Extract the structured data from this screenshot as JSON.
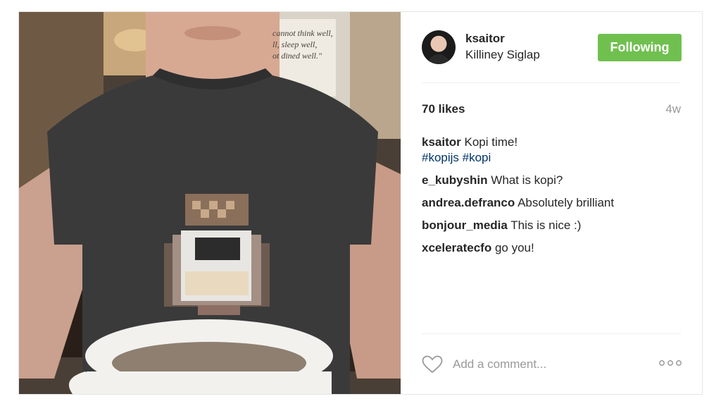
{
  "post": {
    "username": "ksaitor",
    "location": "Killiney Siglap",
    "follow_label": "Following",
    "likes": "70 likes",
    "time_ago": "4w"
  },
  "caption": {
    "user": "ksaitor",
    "text": "Kopi time!",
    "tags": "#kopijs #kopi"
  },
  "comments": [
    {
      "user": "e_kubyshin",
      "text": "What is kopi?"
    },
    {
      "user": "andrea.defranco",
      "text": "Absolutely brilliant"
    },
    {
      "user": "bonjour_media",
      "text": "This is nice :)"
    },
    {
      "user": "xceleratecfo",
      "text": "go you!"
    }
  ],
  "photo_sign": [
    "cannot think well,",
    "ll, sleep well,",
    "ot dined well.\""
  ],
  "footer": {
    "comment_placeholder": "Add a comment..."
  },
  "colors": {
    "follow_green": "#70c050",
    "hashtag": "#003569",
    "muted": "#999999"
  },
  "icons": {
    "like": "heart-icon",
    "more": "more-options-icon"
  }
}
